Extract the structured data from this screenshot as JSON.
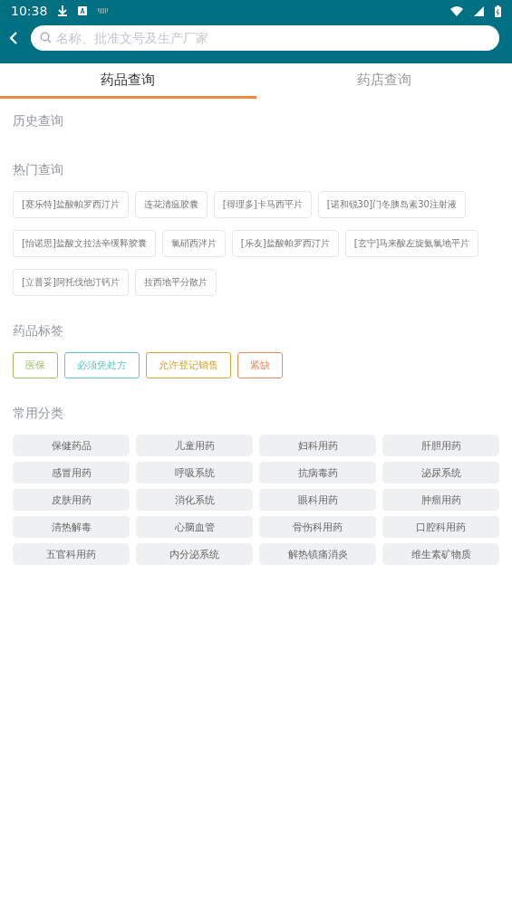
{
  "status_bar": {
    "time": "10:38"
  },
  "search": {
    "placeholder": "名称、批准文号及生产厂家"
  },
  "tabs": [
    {
      "label": "药品查询",
      "selected": true
    },
    {
      "label": "药店查询",
      "selected": false
    }
  ],
  "history": {
    "title": "历史查询"
  },
  "hot": {
    "title": "热门查询",
    "items": [
      "[赛乐特]盐酸帕罗西汀片",
      "连花清瘟胶囊",
      "[得理多]卡马西平片",
      "[诺和锐30]门冬胰岛素30注射液",
      "[怡诺思]盐酸文拉法辛缓释胶囊",
      "氯硝西泮片",
      "[乐友]盐酸帕罗西汀片",
      "[玄宁]马来酸左旋氨氯地平片",
      "[立普妥]阿托伐他汀钙片",
      "拉西地平分散片"
    ]
  },
  "labels": {
    "title": "药品标签",
    "items": [
      {
        "text": "医保",
        "color": "#9bc25c"
      },
      {
        "text": "必须凭处方",
        "color": "#5ec8c8"
      },
      {
        "text": "允许登记销售",
        "color": "#d3a42c"
      },
      {
        "text": "紧缺",
        "color": "#ee8a5c"
      }
    ]
  },
  "categories": {
    "title": "常用分类",
    "items": [
      "保健药品",
      "儿童用药",
      "妇科用药",
      "肝胆用药",
      "感冒用药",
      "呼吸系统",
      "抗病毒药",
      "泌尿系统",
      "皮肤用药",
      "消化系统",
      "眼科用药",
      "肿瘤用药",
      "清热解毒",
      "心脑血管",
      "骨伤科用药",
      "口腔科用药",
      "五官科用药",
      "内分泌系统",
      "解热镇痛消炎",
      "维生素矿物质"
    ]
  }
}
